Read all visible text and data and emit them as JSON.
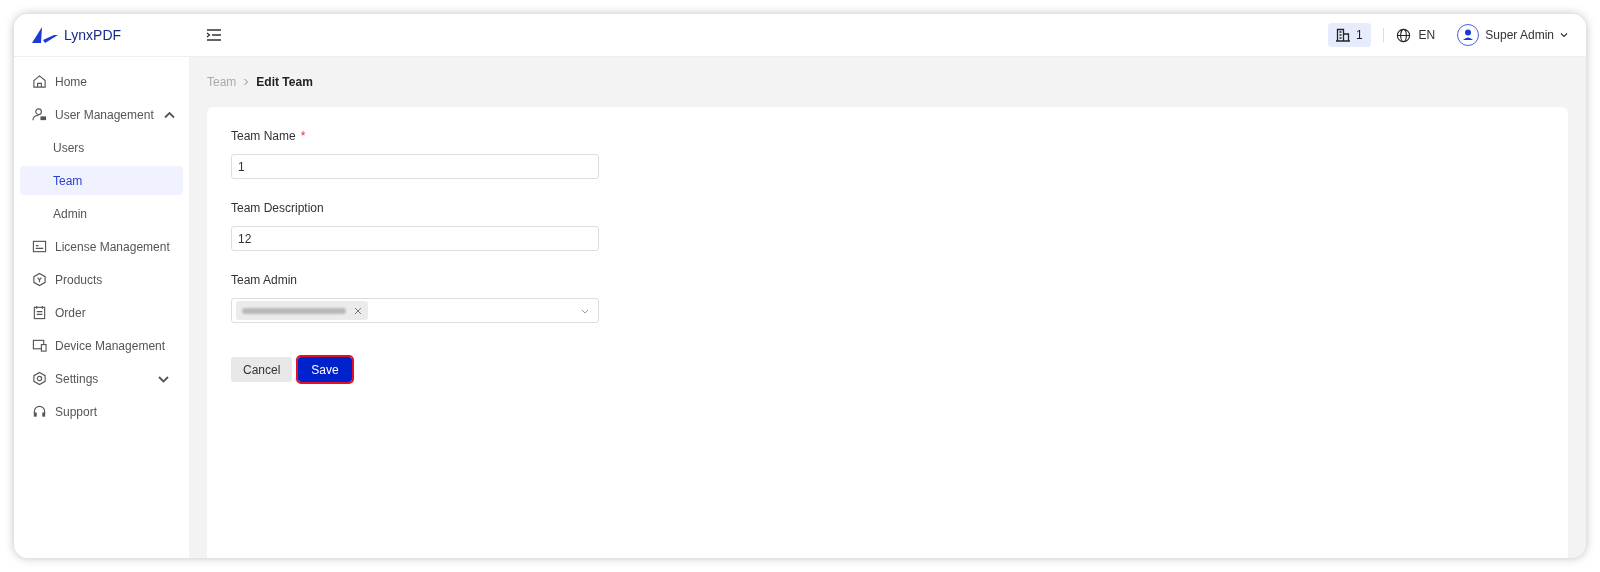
{
  "header": {
    "logo": "LynxPDF",
    "org_count": "1",
    "language": "EN",
    "user": "Super Admin"
  },
  "sidebar": {
    "items": [
      {
        "label": "Home",
        "kind": "home",
        "selected": false
      },
      {
        "label": "User Management",
        "kind": "users",
        "selected": false,
        "expanded": true,
        "children": [
          {
            "label": "Users",
            "selected": false
          },
          {
            "label": "Team",
            "selected": true
          },
          {
            "label": "Admin",
            "selected": false
          }
        ]
      },
      {
        "label": "License Management",
        "kind": "license",
        "selected": false
      },
      {
        "label": "Products",
        "kind": "product",
        "selected": false
      },
      {
        "label": "Order",
        "kind": "order",
        "selected": false
      },
      {
        "label": "Device Management",
        "kind": "device",
        "selected": false
      },
      {
        "label": "Settings",
        "kind": "settings",
        "selected": false,
        "expanded": false
      },
      {
        "label": "Support",
        "kind": "support",
        "selected": false
      }
    ]
  },
  "breadcrumb": [
    "Team",
    "Edit Team"
  ],
  "form": {
    "fields": [
      {
        "kind": "text",
        "label": "Team Name",
        "required_mark": "*",
        "value": "1"
      },
      {
        "kind": "text",
        "label": "Team Description",
        "value": "12"
      },
      {
        "kind": "select",
        "label": "Team Admin",
        "tags": [
          {
            "kind": "redacted"
          }
        ]
      }
    ],
    "buttons": [
      {
        "label": "Cancel",
        "kind": "secondary"
      },
      {
        "label": "Save",
        "kind": "primary"
      }
    ]
  }
}
